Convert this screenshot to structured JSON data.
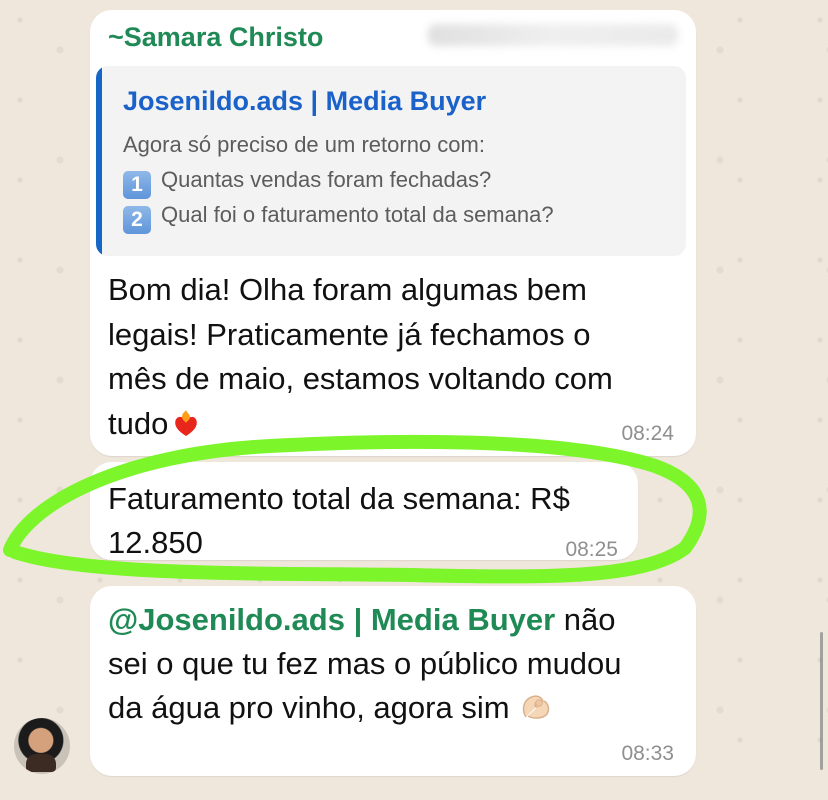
{
  "chat": {
    "sender_name": "~Samara Christo",
    "quoted_message": {
      "author": "Josenildo.ads | Media Buyer",
      "intro": "Agora só preciso de um retorno com:",
      "items": [
        {
          "number": "1",
          "text": "Quantas vendas foram fechadas?"
        },
        {
          "number": "2",
          "text": "Qual foi o faturamento total da semana?"
        }
      ]
    },
    "message_1": {
      "lines": [
        "Bom dia! Olha foram algumas bem",
        "legais! Praticamente já fechamos o",
        "mês de maio, estamos voltando com",
        "tudo"
      ],
      "emoji_icon": "fire-heart-icon",
      "time": "08:24"
    },
    "message_2": {
      "lines": [
        "Faturamento total da semana: R$",
        "12.850"
      ],
      "time": "08:25"
    },
    "message_3": {
      "mention": "@Josenildo.ads | Media Buyer",
      "line_1_rest": " não",
      "line_2": "sei o que tu fez mas o público mudou",
      "line_3": "da água pro vinho, agora sim",
      "emoji_icon": "pinching-hand-icon",
      "time": "08:33"
    }
  },
  "colors": {
    "background": "#efe7dc",
    "bubble": "#ffffff",
    "sender": "#1f8a55",
    "quote_author": "#1a62c9",
    "quote_bar": "#1666c5",
    "highlight": "#7cf52a",
    "time": "#8f8f8f"
  }
}
